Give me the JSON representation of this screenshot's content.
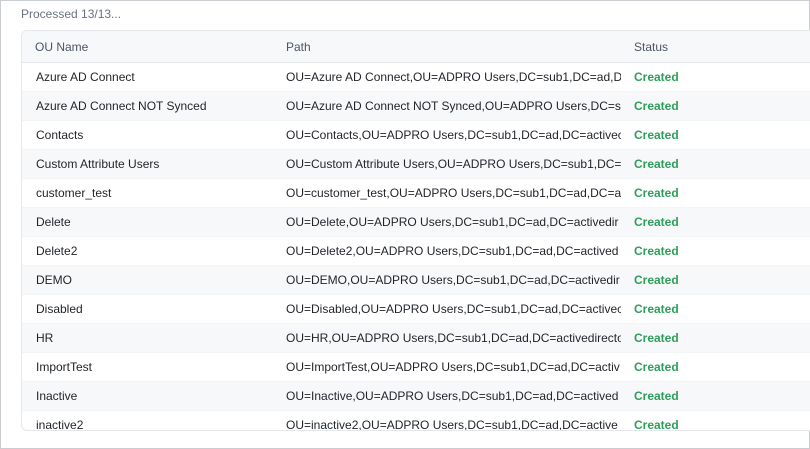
{
  "progress": {
    "label": "Processed 13/13..."
  },
  "table": {
    "headers": {
      "name": "OU Name",
      "path": "Path",
      "status": "Status"
    },
    "rows": [
      {
        "name": "Azure AD Connect",
        "path": "OU=Azure AD Connect,OU=ADPRO Users,DC=sub1,DC=ad,D",
        "status": "Created"
      },
      {
        "name": "Azure AD Connect NOT Synced",
        "path": "OU=Azure AD Connect NOT Synced,OU=ADPRO Users,DC=s",
        "status": "Created"
      },
      {
        "name": "Contacts",
        "path": "OU=Contacts,OU=ADPRO Users,DC=sub1,DC=ad,DC=activec",
        "status": "Created"
      },
      {
        "name": "Custom Attribute Users",
        "path": "OU=Custom Attribute Users,OU=ADPRO Users,DC=sub1,DC=",
        "status": "Created"
      },
      {
        "name": "customer_test",
        "path": "OU=customer_test,OU=ADPRO Users,DC=sub1,DC=ad,DC=a",
        "status": "Created"
      },
      {
        "name": "Delete",
        "path": "OU=Delete,OU=ADPRO Users,DC=sub1,DC=ad,DC=activedir",
        "status": "Created"
      },
      {
        "name": "Delete2",
        "path": "OU=Delete2,OU=ADPRO Users,DC=sub1,DC=ad,DC=actived",
        "status": "Created"
      },
      {
        "name": "DEMO",
        "path": "OU=DEMO,OU=ADPRO Users,DC=sub1,DC=ad,DC=activedir",
        "status": "Created"
      },
      {
        "name": "Disabled",
        "path": "OU=Disabled,OU=ADPRO Users,DC=sub1,DC=ad,DC=activec",
        "status": "Created"
      },
      {
        "name": "HR",
        "path": "OU=HR,OU=ADPRO Users,DC=sub1,DC=ad,DC=activedirecto",
        "status": "Created"
      },
      {
        "name": "ImportTest",
        "path": "OU=ImportTest,OU=ADPRO Users,DC=sub1,DC=ad,DC=activ",
        "status": "Created"
      },
      {
        "name": "Inactive",
        "path": "OU=Inactive,OU=ADPRO Users,DC=sub1,DC=ad,DC=actived",
        "status": "Created"
      },
      {
        "name": "inactive2",
        "path": "OU=inactive2,OU=ADPRO Users,DC=sub1,DC=ad,DC=active",
        "status": "Created"
      }
    ]
  },
  "colors": {
    "status_created": "#2e9e5b",
    "header_bg": "#f7f8fa"
  }
}
